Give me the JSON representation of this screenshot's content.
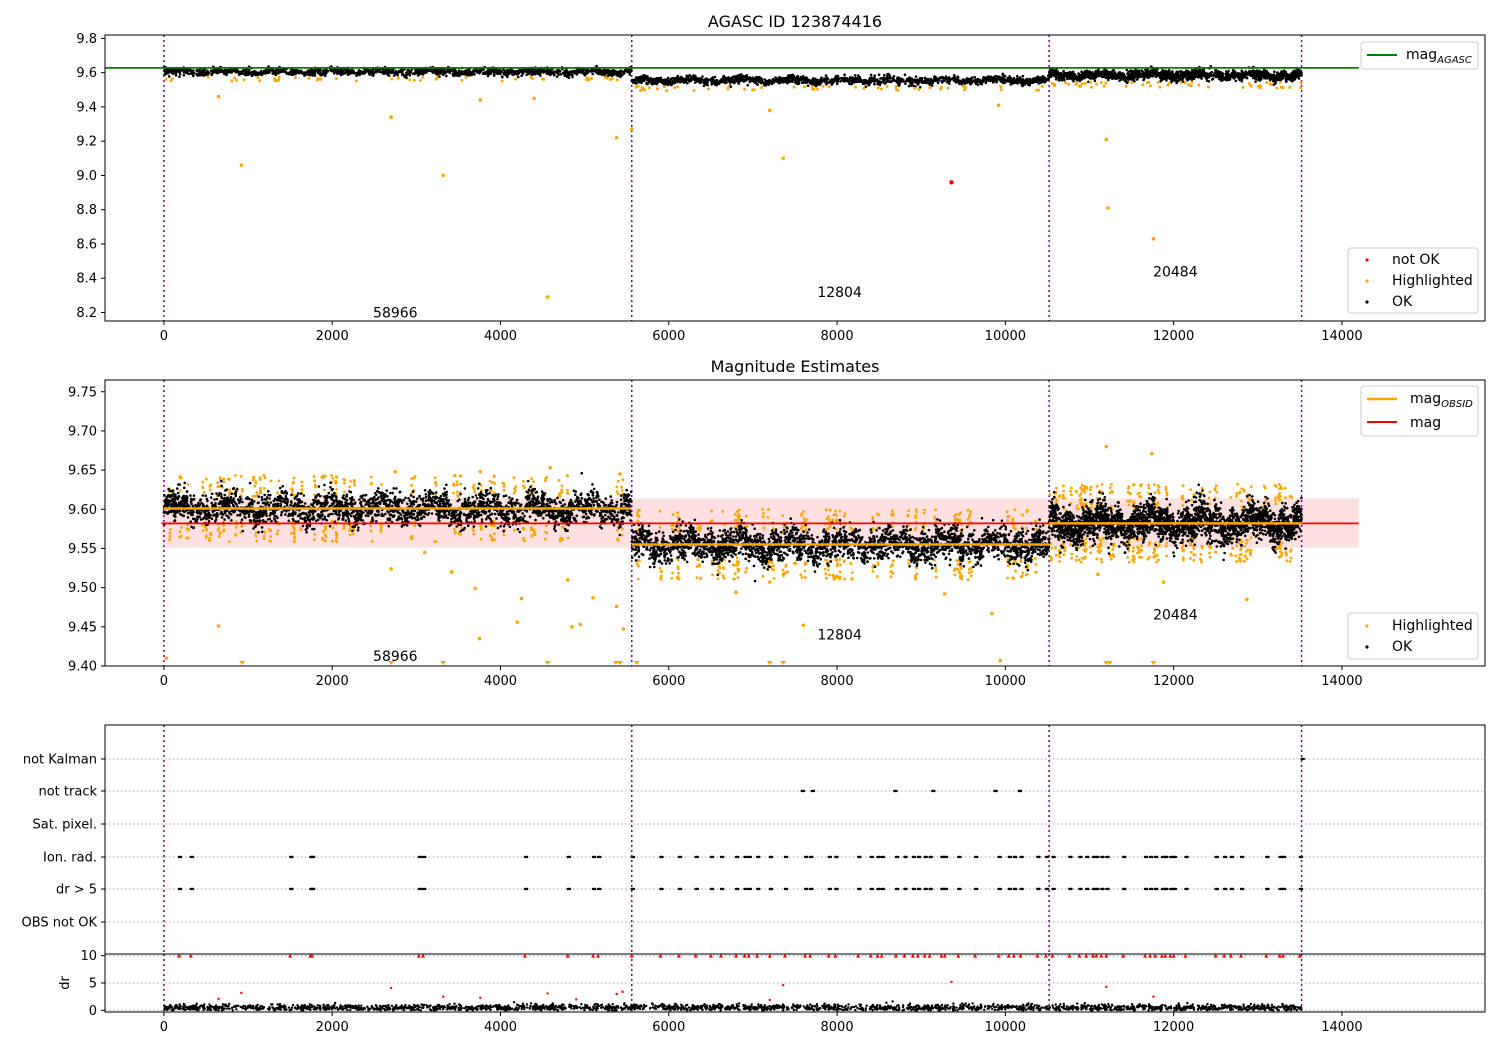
{
  "chart_data": [
    {
      "id": "top",
      "type": "scatter",
      "title": "AGASC ID 123874416",
      "xlim": [
        -700,
        15700
      ],
      "ylim": [
        8.15,
        9.82
      ],
      "xticks": [
        0,
        2000,
        4000,
        6000,
        8000,
        10000,
        12000,
        14000
      ],
      "yticks": [
        8.2,
        8.4,
        8.6,
        8.8,
        9.0,
        9.2,
        9.4,
        9.6,
        9.8
      ],
      "obsid_boundaries": [
        0,
        5560,
        10520,
        13520
      ],
      "obsid_labels": [
        {
          "text": "58966",
          "x": 2750,
          "y": 8.2
        },
        {
          "text": "12804",
          "x": 8030,
          "y": 8.32
        },
        {
          "text": "20484",
          "x": 12020,
          "y": 8.44
        }
      ],
      "lines": [
        {
          "name": "mag_AGASC",
          "color": "#008000",
          "y": 9.628,
          "x": [
            -700,
            14200
          ]
        }
      ],
      "segments": [
        {
          "x": [
            0,
            5560
          ],
          "mean": 9.605,
          "spread": 0.018
        },
        {
          "x": [
            5560,
            10520
          ],
          "mean": 9.555,
          "spread": 0.02
        },
        {
          "x": [
            10520,
            13520
          ],
          "mean": 9.585,
          "spread": 0.025
        }
      ],
      "outliers": {
        "highlighted": [
          [
            920,
            9.06
          ],
          [
            3320,
            9.0
          ],
          [
            2700,
            9.34
          ],
          [
            4560,
            8.29
          ],
          [
            5380,
            9.22
          ],
          [
            5560,
            9.27
          ],
          [
            7360,
            9.1
          ],
          [
            11200,
            9.21
          ],
          [
            11220,
            8.81
          ],
          [
            11760,
            8.63
          ],
          [
            3760,
            9.44
          ],
          [
            7200,
            9.38
          ],
          [
            9920,
            9.41
          ],
          [
            650,
            9.46
          ],
          [
            4400,
            9.45
          ]
        ],
        "not_ok": [
          [
            9360,
            8.96
          ]
        ]
      },
      "legends": [
        {
          "position": "top-right",
          "entries": [
            {
              "name": "mag",
              "sub": "AGASC",
              "color": "#008000",
              "kind": "line"
            }
          ]
        },
        {
          "position": "bottom-right",
          "entries": [
            {
              "name": "not OK",
              "color": "#ff0000",
              "kind": "dot"
            },
            {
              "name": "Highlighted",
              "color": "#ffa500",
              "kind": "dot"
            },
            {
              "name": "OK",
              "color": "#000000",
              "kind": "dot"
            }
          ]
        }
      ]
    },
    {
      "id": "middle",
      "type": "scatter",
      "title": "Magnitude Estimates",
      "xlim": [
        -700,
        15700
      ],
      "ylim": [
        9.4,
        9.765
      ],
      "xticks": [
        0,
        2000,
        4000,
        6000,
        8000,
        10000,
        12000,
        14000
      ],
      "yticks": [
        9.4,
        9.45,
        9.5,
        9.55,
        9.6,
        9.65,
        9.7,
        9.75
      ],
      "obsid_boundaries": [
        0,
        5560,
        10520,
        13520
      ],
      "obsid_labels": [
        {
          "text": "58966",
          "x": 2750,
          "y": 9.413
        },
        {
          "text": "12804",
          "x": 8030,
          "y": 9.44
        },
        {
          "text": "20484",
          "x": 12020,
          "y": 9.466
        }
      ],
      "band": {
        "x": [
          -30,
          14200
        ],
        "y": [
          9.551,
          9.614
        ],
        "color": "#ffcccc"
      },
      "lines": [
        {
          "name": "mag",
          "color": "#ff0000",
          "y": 9.582,
          "x": [
            -30,
            14200
          ]
        },
        {
          "name": "mag_OBSID",
          "color": "#ffa500",
          "segments": [
            {
              "x": [
                0,
                5560
              ],
              "y": 9.601
            },
            {
              "x": [
                5560,
                10520
              ],
              "y": 9.555
            },
            {
              "x": [
                10520,
                13520
              ],
              "y": 9.582
            }
          ]
        }
      ],
      "segments": [
        {
          "x": [
            0,
            5560
          ],
          "mean": 9.601,
          "spread": 0.017
        },
        {
          "x": [
            5560,
            10520
          ],
          "mean": 9.555,
          "spread": 0.018
        },
        {
          "x": [
            10520,
            13520
          ],
          "mean": 9.582,
          "spread": 0.02
        }
      ],
      "outliers": {
        "highlighted": [
          [
            30,
            9.41
          ],
          [
            650,
            9.451
          ],
          [
            2700,
            9.524
          ],
          [
            3100,
            9.545
          ],
          [
            3420,
            9.52
          ],
          [
            3750,
            9.435
          ],
          [
            3700,
            9.499
          ],
          [
            4200,
            9.456
          ],
          [
            4250,
            9.486
          ],
          [
            4800,
            9.51
          ],
          [
            4850,
            9.45
          ],
          [
            4950,
            9.453
          ],
          [
            5100,
            9.487
          ],
          [
            5380,
            9.476
          ],
          [
            5460,
            9.447
          ],
          [
            7200,
            9.507
          ],
          [
            7500,
            9.531
          ],
          [
            7600,
            9.452
          ],
          [
            9280,
            9.492
          ],
          [
            9840,
            9.467
          ],
          [
            9940,
            9.407
          ],
          [
            11100,
            9.517
          ],
          [
            11200,
            9.68
          ],
          [
            11740,
            9.671
          ],
          [
            11880,
            9.507
          ],
          [
            12870,
            9.485
          ],
          [
            6800,
            9.494
          ],
          [
            2750,
            9.648
          ],
          [
            4590,
            9.653
          ],
          [
            3760,
            9.648
          ],
          [
            5420,
            9.645
          ]
        ],
        "clipped": [
          930,
          2700,
          3320,
          4560,
          5370,
          5420,
          5620,
          7200,
          7360,
          11200,
          11240,
          11760
        ]
      },
      "legends": [
        {
          "position": "top-right",
          "entries": [
            {
              "name": "mag",
              "sub": "OBSID",
              "color": "#ffa500",
              "kind": "line"
            },
            {
              "name": "mag",
              "sub": "",
              "color": "#ff0000",
              "kind": "line"
            }
          ]
        },
        {
          "position": "bottom-right",
          "entries": [
            {
              "name": "Highlighted",
              "color": "#ffa500",
              "kind": "dot"
            },
            {
              "name": "OK",
              "color": "#000000",
              "kind": "dot"
            }
          ]
        }
      ]
    },
    {
      "id": "flags",
      "type": "scatter",
      "xlim": [
        -700,
        15700
      ],
      "categories": [
        "not Kalman",
        "not track",
        "Sat. pixel.",
        "Ion. rad.",
        "dr > 5",
        "OBS not OK"
      ],
      "obsid_boundaries": [
        0,
        5560,
        10520,
        13520
      ],
      "flag_points": {
        "not Kalman": [
          13520
        ],
        "not track": [
          7580,
          7700,
          8680,
          9130,
          9870,
          10160
        ],
        "Ion. rad.": [
          180,
          320,
          1500,
          1740,
          1760,
          3030,
          3080,
          4290,
          4800,
          5100,
          5160,
          5560,
          5900,
          6120,
          6320,
          6500,
          6620,
          6800,
          6900,
          6950,
          7050,
          7200,
          7380,
          7620,
          7680,
          7900,
          7980,
          8250,
          8400,
          8480,
          8530,
          8700,
          8800,
          8900,
          8960,
          9040,
          9100,
          9240,
          9280,
          9440,
          9640,
          9920,
          10040,
          10100,
          10180,
          10380,
          10480,
          10560,
          10760,
          10880,
          10960,
          11040,
          11080,
          11140,
          11200,
          11400,
          11660,
          11720,
          11780,
          11860,
          11900,
          11960,
          12000,
          12140,
          12500,
          12600,
          12680,
          12800,
          13100,
          13260,
          13300,
          13500
        ],
        "dr > 5": [
          180,
          320,
          1500,
          1740,
          1760,
          3030,
          3080,
          4290,
          4800,
          5100,
          5160,
          5560,
          5900,
          6120,
          6320,
          6500,
          6620,
          6800,
          6900,
          6950,
          7050,
          7200,
          7380,
          7620,
          7680,
          7900,
          7980,
          8250,
          8400,
          8480,
          8530,
          8700,
          8800,
          8900,
          8960,
          9040,
          9100,
          9240,
          9280,
          9440,
          9640,
          9920,
          10040,
          10100,
          10180,
          10380,
          10480,
          10560,
          10760,
          10880,
          10960,
          11040,
          11080,
          11140,
          11200,
          11400,
          11660,
          11720,
          11780,
          11860,
          11900,
          11960,
          12000,
          12140,
          12500,
          12600,
          12680,
          12800,
          13100,
          13260,
          13300,
          13500
        ]
      }
    },
    {
      "id": "dr",
      "type": "scatter",
      "ylabel": "dr",
      "xlim": [
        -700,
        15700
      ],
      "ylim": [
        -0.3,
        10.3
      ],
      "xticks": [
        0,
        2000,
        4000,
        6000,
        8000,
        10000,
        12000,
        14000
      ],
      "xtick_labels": [
        "0",
        "2000",
        "4000",
        "6000",
        "8000",
        "10000",
        "12000",
        "14000"
      ],
      "yticks": [
        0,
        5,
        10
      ],
      "obsid_boundaries": [
        0,
        5560,
        10520,
        13520
      ],
      "clipped_x": [
        180,
        320,
        1500,
        1740,
        1760,
        3030,
        3080,
        4290,
        4800,
        5100,
        5160,
        5560,
        5900,
        6120,
        6320,
        6500,
        6620,
        6800,
        6900,
        6950,
        7050,
        7200,
        7380,
        7620,
        7680,
        7900,
        7980,
        8250,
        8400,
        8480,
        8530,
        8700,
        8800,
        8900,
        8960,
        9040,
        9100,
        9240,
        9280,
        9440,
        9640,
        9920,
        10040,
        10100,
        10180,
        10380,
        10480,
        10560,
        10760,
        10880,
        10960,
        11040,
        11080,
        11140,
        11200,
        11400,
        11660,
        11720,
        11780,
        11860,
        11900,
        11960,
        12000,
        12140,
        12500,
        12600,
        12680,
        12800,
        13100,
        13260,
        13300,
        13500
      ],
      "scattered": [
        [
          650,
          2.1
        ],
        [
          920,
          3.2
        ],
        [
          2700,
          4.1
        ],
        [
          3320,
          2.5
        ],
        [
          3760,
          2.3
        ],
        [
          4560,
          3.1
        ],
        [
          5380,
          3.0
        ],
        [
          5450,
          3.4
        ],
        [
          7360,
          4.6
        ],
        [
          9360,
          5.2
        ],
        [
          11200,
          4.3
        ],
        [
          11760,
          2.5
        ],
        [
          4900,
          2.0
        ],
        [
          7200,
          1.9
        ]
      ]
    }
  ],
  "colors": {
    "ok": "#000000",
    "highlighted": "#ffa500",
    "not_ok": "#ff0000",
    "boundary": "#800080",
    "band": "#ffcccc",
    "mag_line": "#ff0000",
    "agasc_line": "#008000",
    "obsid_line": "#ffa500"
  }
}
